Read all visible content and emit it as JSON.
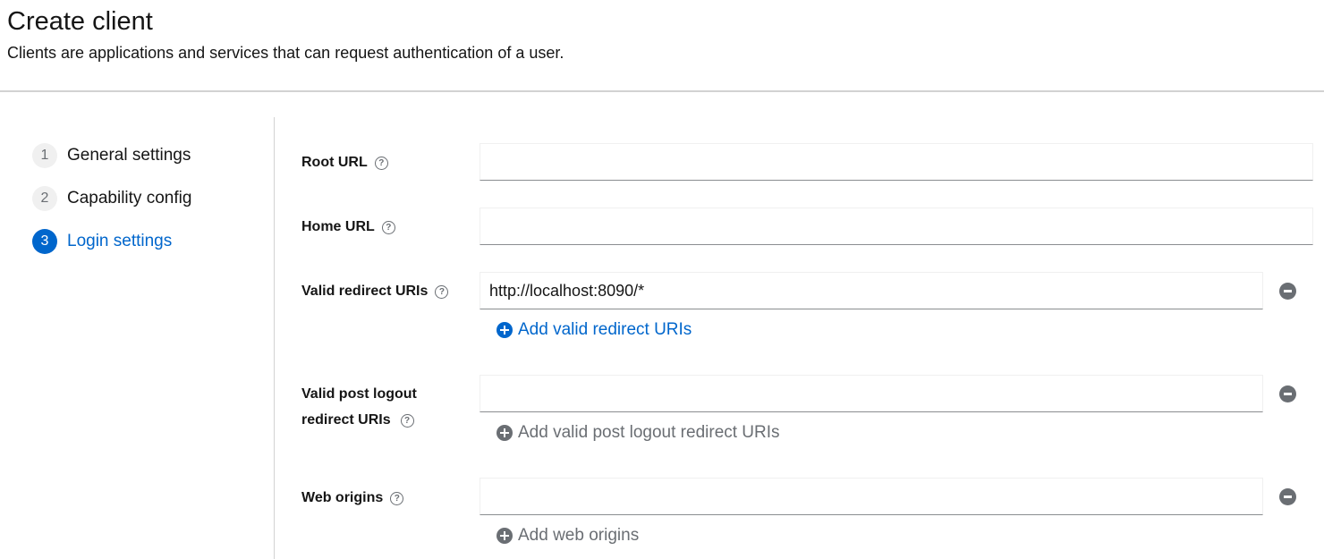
{
  "header": {
    "title": "Create client",
    "subtitle": "Clients are applications and services that can request authentication of a user."
  },
  "wizard": {
    "steps": [
      {
        "number": "1",
        "label": "General settings",
        "current": false
      },
      {
        "number": "2",
        "label": "Capability config",
        "current": false
      },
      {
        "number": "3",
        "label": "Login settings",
        "current": true
      }
    ]
  },
  "form": {
    "root_url": {
      "label": "Root URL",
      "value": ""
    },
    "home_url": {
      "label": "Home URL",
      "value": ""
    },
    "valid_redirect_uris": {
      "label": "Valid redirect URIs",
      "value": "http://localhost:8090/*",
      "add_label": "Add valid redirect URIs"
    },
    "valid_post_logout": {
      "label_line1": "Valid post logout",
      "label_line2": "redirect URIs",
      "value": "",
      "add_label": "Add valid post logout redirect URIs"
    },
    "web_origins": {
      "label": "Web origins",
      "value": "",
      "add_label": "Add web origins"
    }
  },
  "icons": {
    "help": "question-circle-icon",
    "remove": "minus-circle-icon",
    "add": "plus-circle-icon"
  },
  "colors": {
    "accent": "#0066cc",
    "muted": "#6a6e73",
    "divider": "#d2d2d2"
  }
}
